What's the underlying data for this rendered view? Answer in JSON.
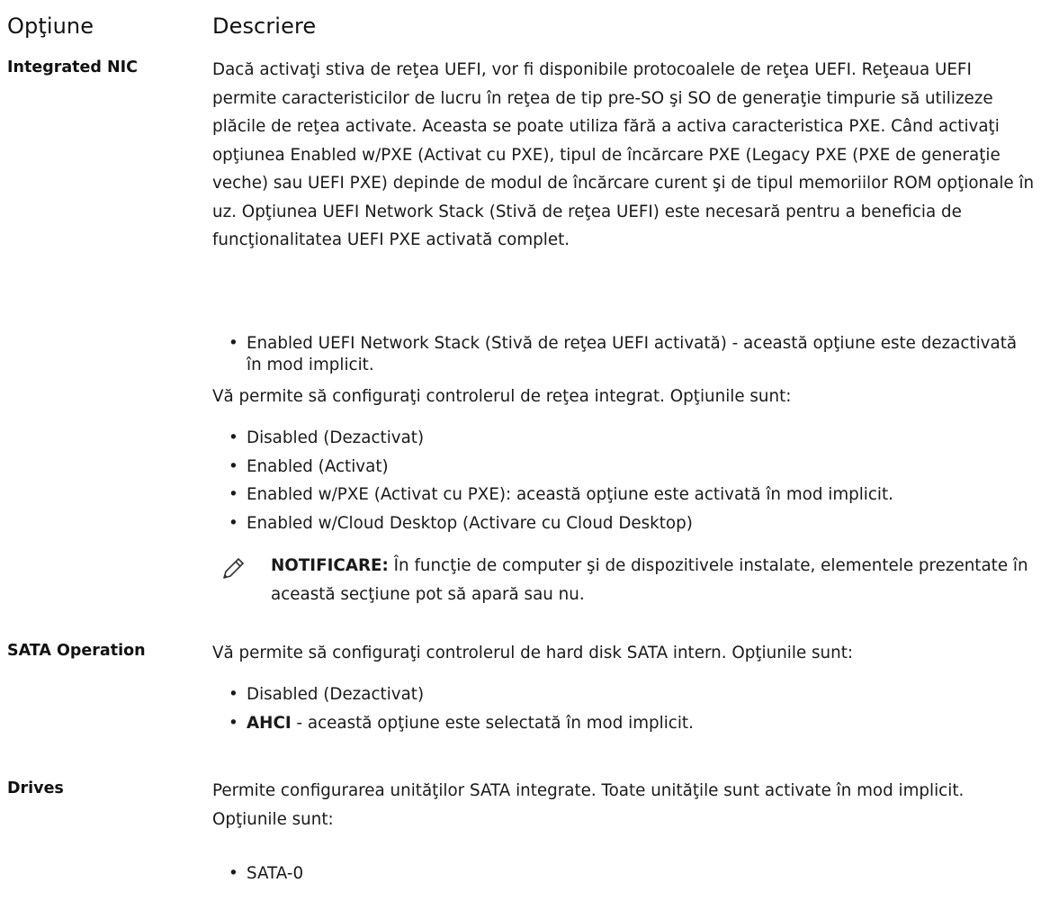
{
  "header": {
    "option": "Opţiune",
    "description": "Descriere"
  },
  "integrated_nic": {
    "label": "Integrated NIC",
    "paragraph": "Dacă activaţi stiva de reţea UEFI, vor fi disponibile protocoalele de reţea UEFI. Reţeaua UEFI permite caracteristicilor de lucru în reţea de tip pre-SO şi SO de generaţie timpurie să utilizeze plăcile de reţea activate. Aceasta se poate utiliza fără a activa caracteristica PXE. Când activaţi opţiunea Enabled w/PXE (Activat cu PXE), tipul de încărcare PXE (Legacy PXE (PXE de generaţie veche) sau UEFI PXE) depinde de modul de încărcare curent şi de tipul memoriilor ROM opţionale în uz. Opţiunea UEFI Network Stack (Stivă de reţea UEFI) este necesară pentru a beneficia de funcţionalitatea UEFI PXE activată complet.",
    "stack_bullet": "Enabled UEFI Network Stack (Stivă de reţea UEFI activată) - această opţiune este dezactivată în mod implicit.",
    "configure_text": "Vă permite să configuraţi controlerul de reţea integrat. Opţiunile sunt:",
    "options": [
      "Disabled (Dezactivat)",
      "Enabled (Activat)",
      "Enabled w/PXE (Activat cu PXE): această opţiune este activată în mod implicit.",
      "Enabled w/Cloud Desktop (Activare cu Cloud Desktop)"
    ],
    "note_label": "NOTIFICARE:",
    "note_text": " În funcţie de computer şi de dispozitivele instalate, elementele prezentate în această secţiune pot să apară sau nu."
  },
  "sata_operation": {
    "label": "SATA Operation",
    "text": "Vă permite să configuraţi controlerul de hard disk SATA intern. Opţiunile sunt:",
    "option_1": "Disabled (Dezactivat)",
    "option_2_bold": "AHCI",
    "option_2_rest": " - această opţiune este selectată în mod implicit."
  },
  "drives": {
    "label": "Drives",
    "text": "Permite configurarea unităţilor SATA integrate. Toate unităţile sunt activate în mod implicit. Opţiunile sunt:",
    "option_1": "SATA-0"
  },
  "icon_name": "pencil-note-icon"
}
